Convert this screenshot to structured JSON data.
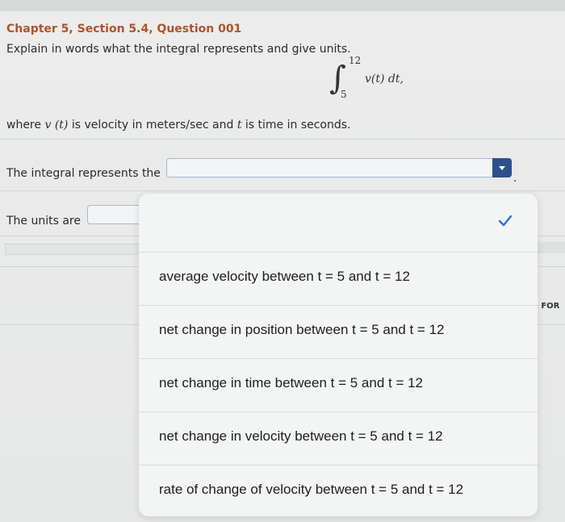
{
  "question": {
    "title": "Chapter 5, Section 5.4, Question 001",
    "prompt": "Explain in words what the integral represents and give units.",
    "integral": {
      "upper_limit": "12",
      "lower_limit": "5",
      "expression": "v(t) dt,"
    },
    "where_text_pre": "where ",
    "where_v": "v (t)",
    "where_mid": " is velocity in meters/sec and ",
    "where_t": "t",
    "where_post": " is time in seconds."
  },
  "form": {
    "integral_label": "The integral represents the",
    "units_label": "The units are",
    "period": "."
  },
  "side_text": "E FOR",
  "dropdown": {
    "check_color": "#2f6fd6",
    "options": [
      "average velocity between t = 5 and t = 12",
      "net change in position between t = 5 and t = 12",
      "net change in time between t = 5 and t = 12",
      "net change in velocity between t = 5 and t = 12",
      "rate of change of velocity between t = 5 and t = 12"
    ]
  }
}
